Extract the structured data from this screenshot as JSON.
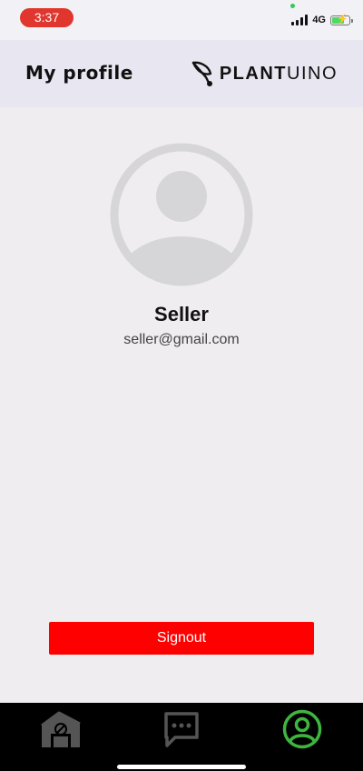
{
  "status_bar": {
    "time": "3:37",
    "network": "4G",
    "battery_level": 0.75,
    "charging": true
  },
  "header": {
    "title": "My profile",
    "brand_bold": "PLANT",
    "brand_light": "UINO"
  },
  "profile": {
    "name": "Seller",
    "email": "seller@gmail.com"
  },
  "actions": {
    "signout_label": "Signout"
  },
  "tab_bar": {
    "items": [
      {
        "icon": "greenhouse-icon",
        "active": false
      },
      {
        "icon": "chat-icon",
        "active": false
      },
      {
        "icon": "user-circle-icon",
        "active": true
      }
    ]
  },
  "colors": {
    "signout_button": "#fe0000",
    "active_tab": "#3eb53e",
    "inactive_tab": "#555555",
    "time_pill": "#e0362d",
    "header_bg": "#e7e6f1",
    "page_bg": "#efedf0"
  }
}
